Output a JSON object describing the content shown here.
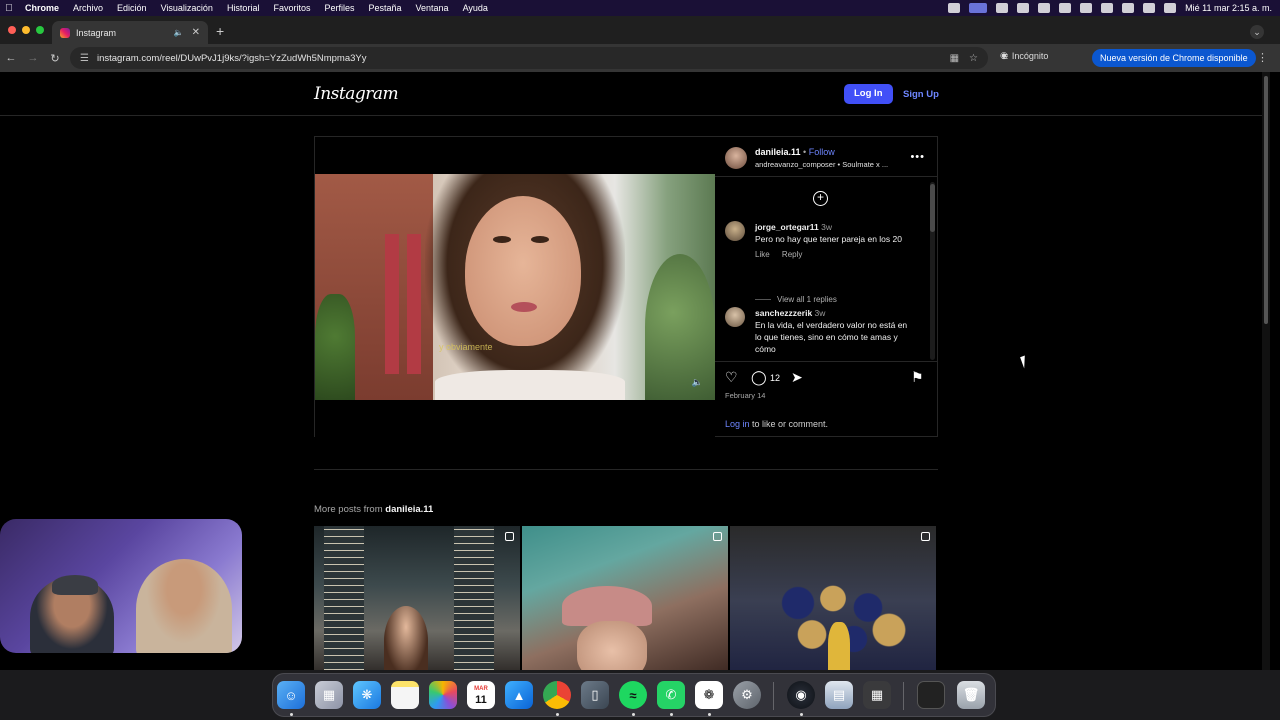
{
  "menubar": {
    "app": "Chrome",
    "items": [
      "Archivo",
      "Edición",
      "Visualización",
      "Historial",
      "Favoritos",
      "Perfiles",
      "Pestaña",
      "Ventana",
      "Ayuda"
    ],
    "clock": "Mié 11 mar  2:15 a. m."
  },
  "tab": {
    "title": "Instagram"
  },
  "toolbar": {
    "url": "instagram.com/reel/DUwPvJ1j9ks/?igsh=YzZudWh5Nmpma3Yy",
    "incognito_label": "Incógnito",
    "update_label": "Nueva versión de Chrome disponible"
  },
  "header": {
    "logo": "Instagram",
    "login": "Log In",
    "signup": "Sign Up"
  },
  "post": {
    "username": "danileia.11",
    "separator": "•",
    "follow": "Follow",
    "audio": "andreavanzo_composer • Soulmate x ...",
    "video_caption": "y obviamente",
    "comments": [
      {
        "user": "jorge_ortegar11",
        "time": "3w",
        "text": "Pero no hay que tener pareja en los 20",
        "like": "Like",
        "reply": "Reply"
      },
      {
        "user": "sanchezzzerik",
        "time": "3w",
        "text": "En la vida, el verdadero valor no está en lo que tienes, sino en cómo te amas y cómo"
      }
    ],
    "view_replies": "View all 1 replies",
    "comment_count": "12",
    "date": "February 14",
    "login_link": "Log in",
    "login_suffix": " to like or comment."
  },
  "more_posts": {
    "prefix": "More posts from ",
    "username": "danileia.11"
  },
  "dock": {
    "calendar_month": "MAR",
    "calendar_day": "11"
  },
  "colors": {
    "accent": "#4150f7",
    "link": "#6e86ff",
    "chrome_update": "#0b57d0"
  }
}
